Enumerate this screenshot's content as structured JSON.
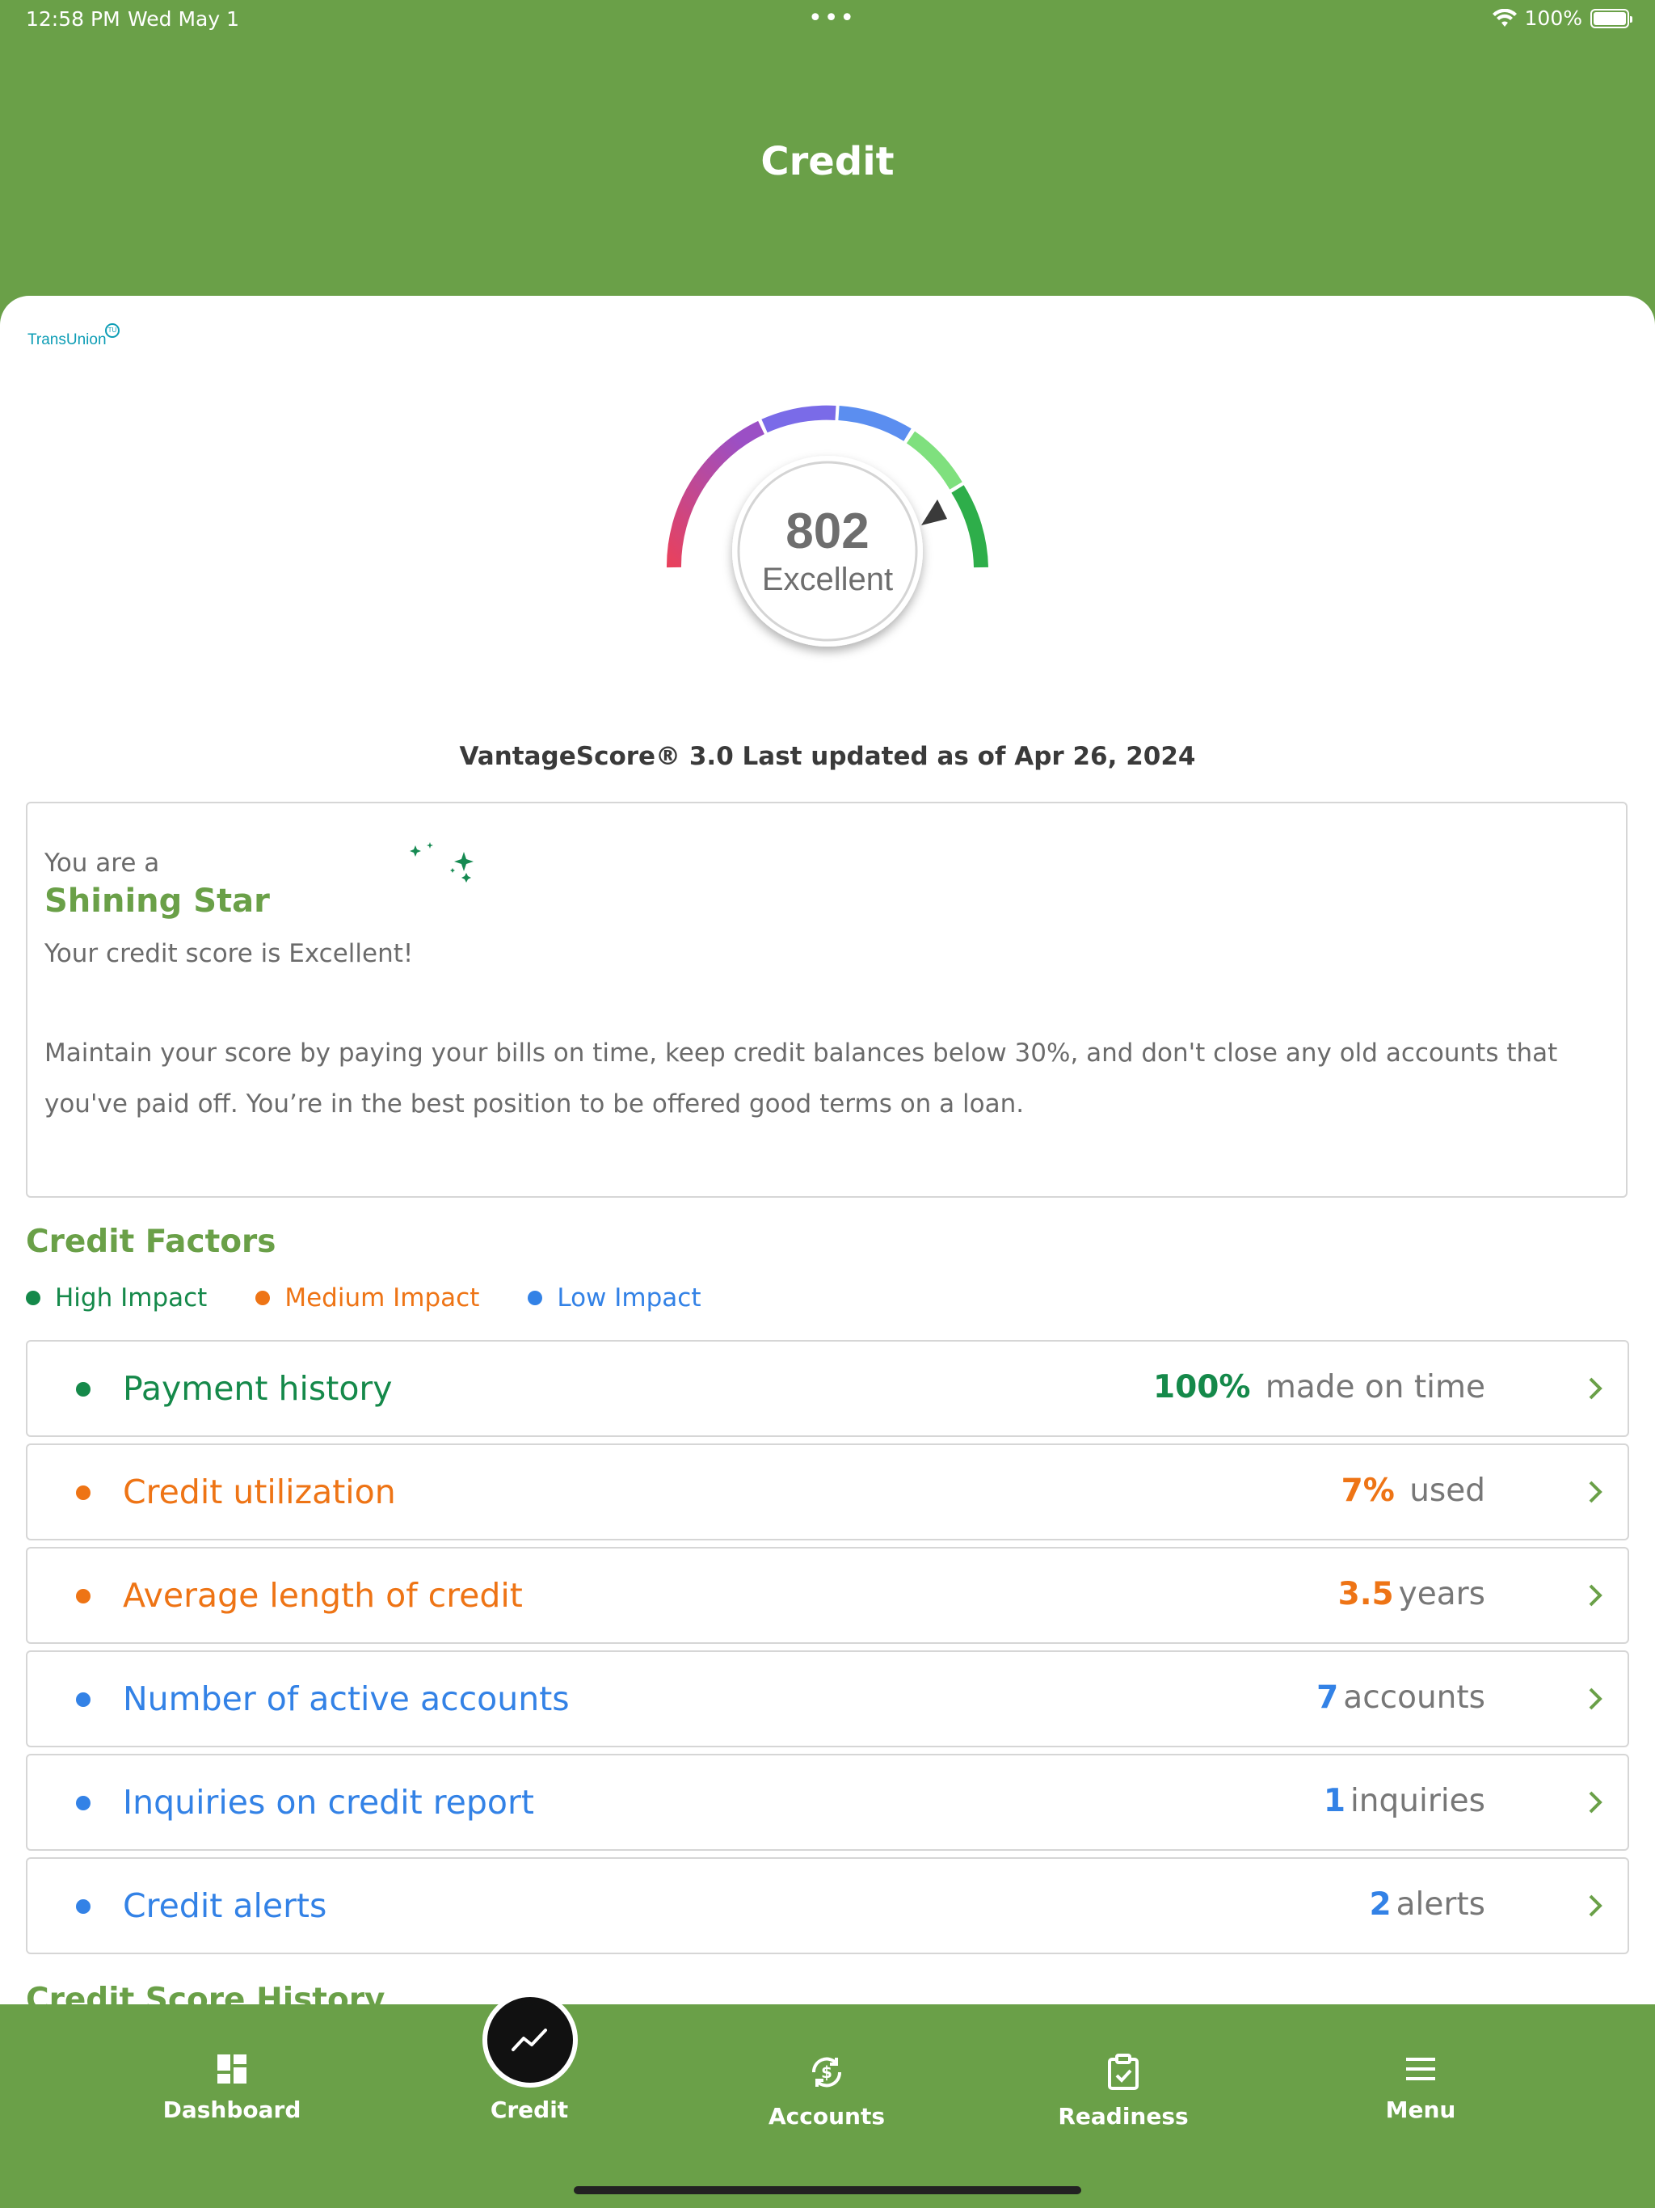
{
  "status_bar": {
    "time": "12:58 PM",
    "date": "Wed May 1",
    "dots": "•••",
    "battery": "100%"
  },
  "header": {
    "title": "Credit"
  },
  "brand": {
    "logo_text": "TransUnion",
    "logo_mark": "TU"
  },
  "score": {
    "value": "802",
    "rating": "Excellent",
    "caption": "VantageScore® 3.0 Last updated as of Apr 26, 2024",
    "gauge_level": 0.9
  },
  "status_card": {
    "prefix": "You are a",
    "badge": "Shining Star",
    "line": "Your credit score is Excellent!",
    "paragraph": "Maintain your score by paying your bills on time, keep credit balances below 30%, and don't close any old accounts that you've paid off. You’re in the best position to be offered good terms on a loan."
  },
  "credit_factors": {
    "title": "Credit Factors",
    "legend": [
      {
        "label": "High Impact",
        "color": "#15894a"
      },
      {
        "label": "Medium Impact",
        "color": "#ee7415"
      },
      {
        "label": "Low Impact",
        "color": "#3382e6"
      }
    ],
    "items": [
      {
        "name": "Payment history",
        "value": "100%",
        "unit": "made on time",
        "color": "#15894a"
      },
      {
        "name": "Credit utilization",
        "value": "7%",
        "unit": "used",
        "color": "#ee7415"
      },
      {
        "name": "Average length of credit",
        "value": "3.5",
        "unit": "years",
        "color": "#ee7415"
      },
      {
        "name": "Number of active accounts",
        "value": "7",
        "unit": "accounts",
        "color": "#3382e6"
      },
      {
        "name": "Inquiries on credit report",
        "value": "1",
        "unit": "inquiries",
        "color": "#3382e6"
      },
      {
        "name": "Credit alerts",
        "value": "2",
        "unit": "alerts",
        "color": "#3382e6"
      }
    ]
  },
  "history": {
    "title": "Credit Score History"
  },
  "tabs": {
    "dashboard": "Dashboard",
    "credit": "Credit",
    "accounts": "Accounts",
    "readiness": "Readiness",
    "menu": "Menu"
  },
  "colors": {
    "brand_green": "#6aa048",
    "chevron": "#6aa048"
  }
}
